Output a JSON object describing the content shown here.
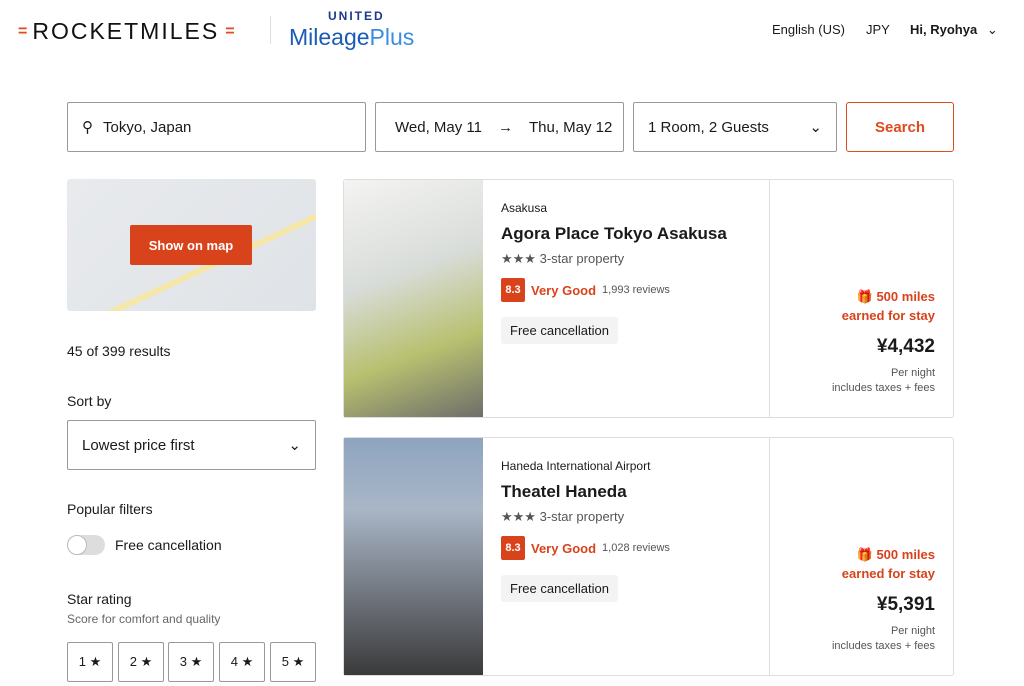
{
  "header": {
    "logo": "ROCKETMILES",
    "partner_top": "UNITED",
    "partner_main": "Mileage",
    "partner_plus": "Plus",
    "language": "English (US)",
    "currency": "JPY",
    "user": "Hi, Ryohya"
  },
  "search": {
    "destination": "Tokyo, Japan",
    "checkin": "Wed, May 11",
    "checkout": "Thu, May 12",
    "guests": "1 Room, 2 Guests",
    "button": "Search"
  },
  "sidebar": {
    "map_button": "Show on map",
    "results": "45 of 399 results",
    "sort_label": "Sort by",
    "sort_value": "Lowest price first",
    "popular_filters": "Popular filters",
    "free_cancel": "Free cancellation",
    "free_cancel_on": false,
    "star_title": "Star rating",
    "star_sub": "Score for comfort and quality",
    "stars": [
      "1 ★",
      "2 ★",
      "3 ★",
      "4 ★",
      "5 ★"
    ]
  },
  "hotels": [
    {
      "area": "Asakusa",
      "name": "Agora Place Tokyo Asakusa",
      "stars": "★★★",
      "class": "3-star property",
      "score": "8.3",
      "rating": "Very Good",
      "reviews": "1,993 reviews",
      "tag": "Free cancellation",
      "miles": "500 miles",
      "miles_sub": "earned for stay",
      "price": "¥4,432",
      "per": "Per night",
      "fees": "includes taxes + fees"
    },
    {
      "area": "Haneda International Airport",
      "name": "Theatel Haneda",
      "stars": "★★★",
      "class": "3-star property",
      "score": "8.3",
      "rating": "Very Good",
      "reviews": "1,028 reviews",
      "tag": "Free cancellation",
      "miles": "500 miles",
      "miles_sub": "earned for stay",
      "price": "¥5,391",
      "per": "Per night",
      "fees": "includes taxes + fees"
    }
  ],
  "colors": {
    "accent": "#d8431c",
    "united": "#1a3a8c"
  }
}
